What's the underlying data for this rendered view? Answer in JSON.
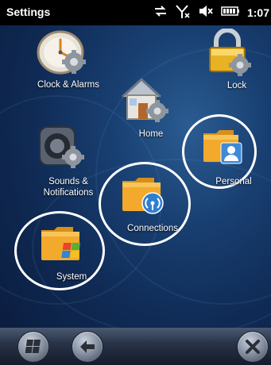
{
  "statusbar": {
    "title": "Settings",
    "time": "1:07",
    "icons": [
      "sync-icon",
      "no-signal-icon",
      "volume-muted-icon",
      "battery-icon"
    ]
  },
  "tiles": {
    "clock": {
      "label": "Clock & Alarms",
      "icon": "clock-gear-icon"
    },
    "lock": {
      "label": "Lock",
      "icon": "padlock-gear-icon"
    },
    "home": {
      "label": "Home",
      "icon": "house-gear-icon"
    },
    "sounds": {
      "label": "Sounds &\nNotifications",
      "label_line1": "Sounds &",
      "label_line2": "Notifications",
      "icon": "speaker-gear-icon"
    },
    "personal": {
      "label": "Personal",
      "icon": "folder-contact-icon"
    },
    "connections": {
      "label": "Connections",
      "icon": "folder-wireless-icon"
    },
    "system": {
      "label": "System",
      "icon": "folder-windows-icon"
    }
  },
  "bottombar": {
    "buttons": [
      "windows-start-icon",
      "back-arrow-icon",
      "close-x-icon"
    ]
  },
  "colors": {
    "background": "#183e70",
    "statusbar": "#000000",
    "folder": "#f0a62a",
    "highlight_ring": "#ffffff"
  }
}
